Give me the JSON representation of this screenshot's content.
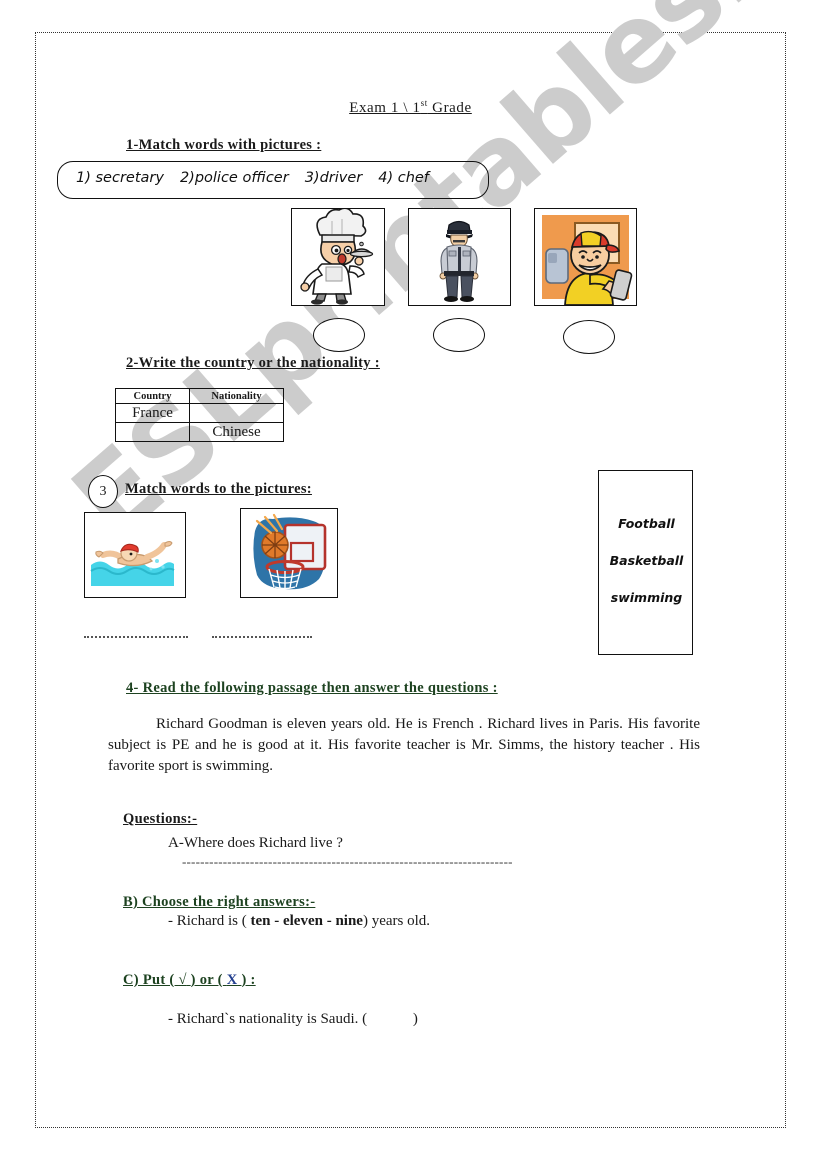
{
  "document": {
    "title_main": "Exam 1 \\ 1",
    "title_sup": "st",
    "title_tail": " Grade",
    "watermark": "ESLprintables.com",
    "colors": {
      "heading_green": "#1d4220",
      "heading_blue": "#24408f",
      "body_text": "#1a1a1a",
      "watermark": "#cccccc"
    }
  },
  "exercise1": {
    "heading": "1-Match words with pictures :",
    "wordbank": [
      "1) secretary",
      "2)police officer",
      "3)driver",
      "4) chef"
    ],
    "pictures": [
      {
        "name": "chef-picture",
        "alt": "chef holding a serving tray"
      },
      {
        "name": "police-officer-picture",
        "alt": "police officer standing"
      },
      {
        "name": "driver-picture",
        "alt": "bus driver at the wheel"
      }
    ],
    "answer_slots": [
      "",
      "",
      ""
    ]
  },
  "exercise2": {
    "heading": "2-Write the country or the nationality :",
    "table": {
      "headers": [
        "Country",
        "Nationality"
      ],
      "rows": [
        [
          "France",
          ""
        ],
        [
          "",
          "Chinese"
        ]
      ]
    }
  },
  "exercise3": {
    "number": "3",
    "heading": "Match words to the pictures:",
    "pictures": [
      {
        "name": "swimming-picture",
        "alt": "person swimming in water"
      },
      {
        "name": "basketball-picture",
        "alt": "basketball going into hoop"
      }
    ],
    "answer_lines": [
      "........................",
      "........................"
    ],
    "wordbox": [
      "Football",
      "Basketball",
      "swimming"
    ]
  },
  "exercise4": {
    "heading": "4-  Read the following passage then answer the questions :",
    "passage": "Richard Goodman is eleven years old. He  is French . Richard lives in Paris. His favorite subject is PE and he is good at it. His favorite teacher is Mr. Simms, the history teacher . His favorite  sport is swimming.",
    "questions_label": "Questions:-",
    "question_a": "A-Where does Richard live ?",
    "answer_dashes": "-------------------------------------------------------------------------",
    "part_b": {
      "heading": "B) Choose the right answers:-",
      "item_prefix": "- Richard is (",
      "options": "ten - eleven - nine",
      "item_suffix": ")  years old."
    },
    "part_c": {
      "heading_1": "C) Put (",
      "heading_check": "√",
      "heading_2": ") or (",
      "heading_x": "X",
      "heading_3": ") :",
      "item": "- Richard`s nationality is Saudi.  (",
      "item_close": ")"
    }
  }
}
